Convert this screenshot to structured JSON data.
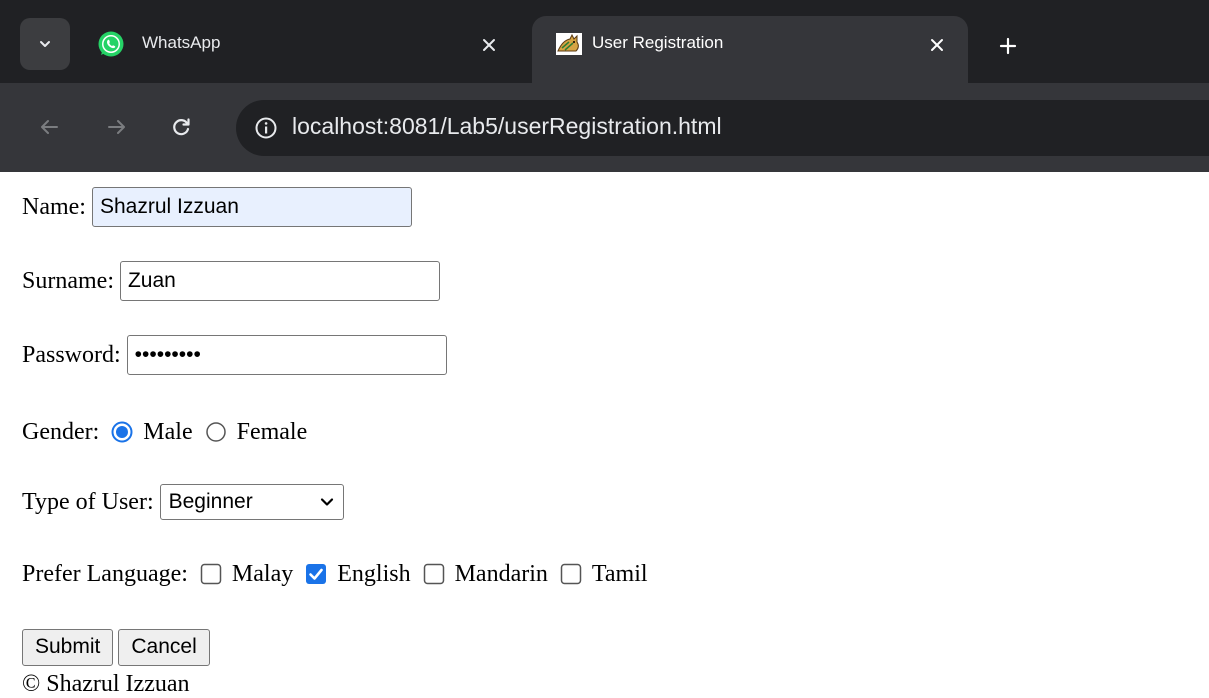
{
  "browser": {
    "tabs": [
      {
        "title": "WhatsApp",
        "icon": "whatsapp-icon",
        "active": false
      },
      {
        "title": "User Registration",
        "icon": "tomcat-icon",
        "active": true
      }
    ],
    "url": "localhost:8081/Lab5/userRegistration.html"
  },
  "form": {
    "name_label": "Name:",
    "name_value": "Shazrul Izzuan",
    "surname_label": "Surname:",
    "surname_value": "Zuan",
    "password_label": "Password:",
    "password_masked": "•••••••••",
    "gender_label": "Gender:",
    "gender_options": [
      {
        "label": "Male",
        "checked": true
      },
      {
        "label": "Female",
        "checked": false
      }
    ],
    "user_type_label": "Type of User:",
    "user_type_selected": "Beginner",
    "language_label": "Prefer Language:",
    "languages": [
      {
        "label": "Malay",
        "checked": false
      },
      {
        "label": "English",
        "checked": true
      },
      {
        "label": "Mandarin",
        "checked": false
      },
      {
        "label": "Tamil",
        "checked": false
      }
    ],
    "submit_label": "Submit",
    "cancel_label": "Cancel"
  },
  "footer": {
    "text": "© Shazrul Izzuan"
  },
  "colors": {
    "accent": "#1a73e8",
    "chrome_dark": "#202124",
    "chrome_toolbar": "#35363a",
    "autofill": "#e8f0fe"
  }
}
